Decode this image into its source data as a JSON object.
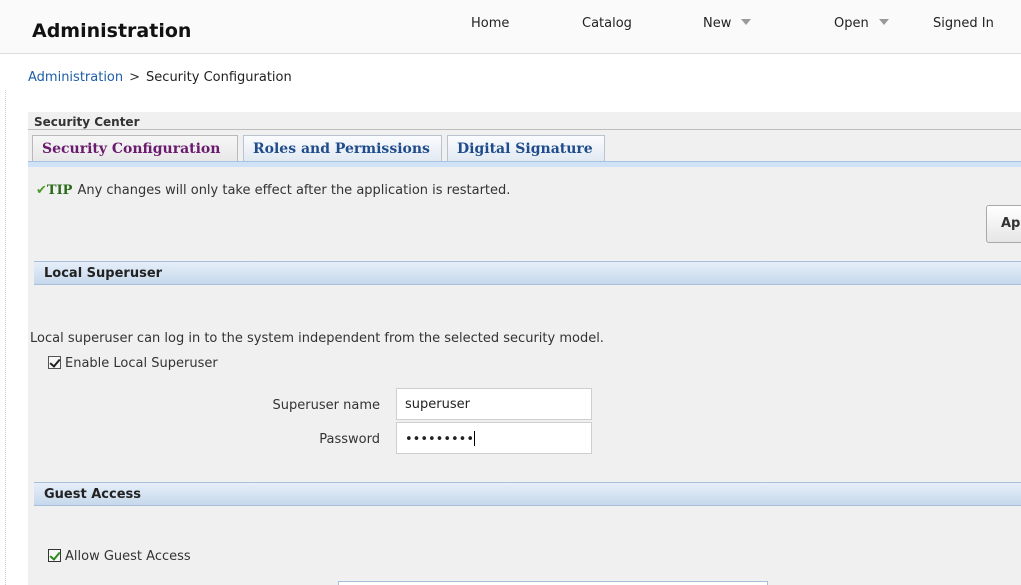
{
  "header": {
    "title": "Administration",
    "nav": [
      {
        "label": "Home",
        "has_menu": false
      },
      {
        "label": "Catalog",
        "has_menu": false
      },
      {
        "label": "New",
        "has_menu": true
      },
      {
        "label": "Open",
        "has_menu": true
      },
      {
        "label": "Signed In",
        "has_menu": false
      }
    ]
  },
  "breadcrumb": {
    "parent": "Administration",
    "separator": ">",
    "current": "Security Configuration"
  },
  "security_center": {
    "title": "Security Center",
    "tabs": [
      {
        "label": "Security Configuration",
        "active": true
      },
      {
        "label": "Roles and Permissions",
        "active": false
      },
      {
        "label": "Digital Signature",
        "active": false
      }
    ]
  },
  "tip": {
    "icon": "check-icon",
    "label": "TIP",
    "text": "Any changes will only take effect after the application is restarted."
  },
  "apply_button": {
    "label": "Ap"
  },
  "local_superuser": {
    "title": "Local Superuser",
    "description": "Local superuser can log in to the system independent from the selected security model.",
    "enable_label": "Enable Local Superuser",
    "enable_checked": true,
    "name_label": "Superuser name",
    "name_value": "superuser",
    "password_label": "Password",
    "password_value": "•••••••••"
  },
  "guest_access": {
    "title": "Guest Access",
    "allow_label": "Allow Guest Access",
    "allow_checked": true
  },
  "colors": {
    "accent": "#1e5fa8",
    "active_tab_text": "#6a1b6e",
    "tip_green": "#2a6a1b",
    "section_bar": "#c6d8ec"
  }
}
